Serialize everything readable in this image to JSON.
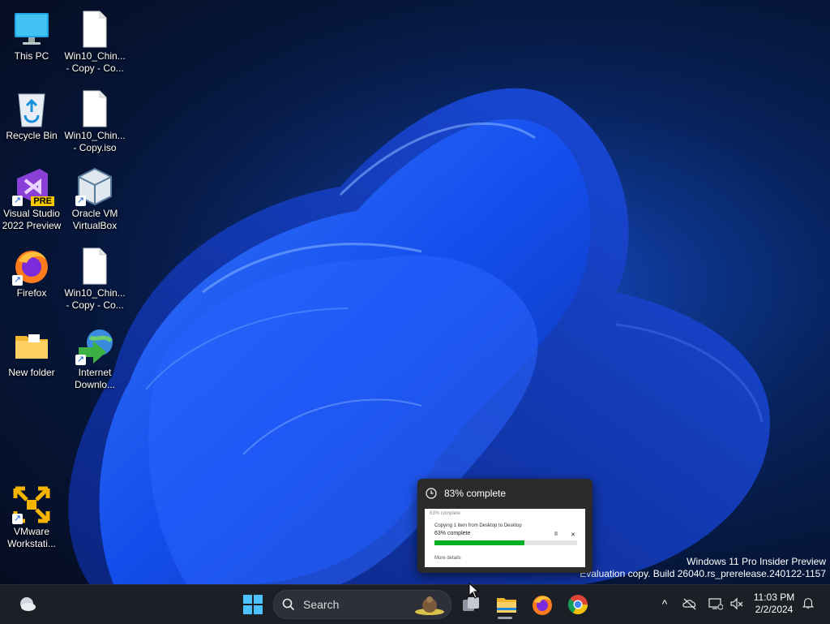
{
  "desktop": {
    "icons": [
      {
        "id": "this-pc",
        "label": "This PC"
      },
      {
        "id": "win10-1",
        "label": "Win10_Chin... - Copy - Co..."
      },
      {
        "id": "recycle-bin",
        "label": "Recycle Bin"
      },
      {
        "id": "win10-2",
        "label": "Win10_Chin... - Copy.iso"
      },
      {
        "id": "visual-studio",
        "label": "Visual Studio 2022 Preview",
        "badge": "PRE"
      },
      {
        "id": "virtualbox",
        "label": "Oracle VM VirtualBox"
      },
      {
        "id": "firefox",
        "label": "Firefox"
      },
      {
        "id": "win10-3",
        "label": "Win10_Chin... - Copy - Co..."
      },
      {
        "id": "new-folder",
        "label": "New folder"
      },
      {
        "id": "idm",
        "label": "Internet Downlo..."
      },
      {
        "id": "vmware",
        "label": "VMware Workstati..."
      }
    ]
  },
  "watermark": {
    "line1": "Windows 11 Pro Insider Preview",
    "line2": "Evaluation copy. Build 26040.rs_prerelease.240122-1157"
  },
  "copy_preview": {
    "title": "83% complete",
    "window_title": "63% complete",
    "copying_text": "Copying 1 item from Desktop to Desktop",
    "status": "63% complete",
    "progress": 0.63,
    "more_details": "More details",
    "pause_glyph": "II",
    "close_glyph": "✕"
  },
  "taskbar": {
    "search_placeholder": "Search",
    "apps": [
      "widgets-icon",
      "start-icon",
      "task-view-icon",
      "file-explorer-icon",
      "firefox-icon",
      "chrome-icon"
    ],
    "tray_chevron": "^",
    "time": "11:03 PM",
    "date": "2/2/2024"
  },
  "colors": {
    "accent": "#0067c0",
    "progress_green": "#06b025",
    "taskbar_bg": "#1c1f26"
  }
}
